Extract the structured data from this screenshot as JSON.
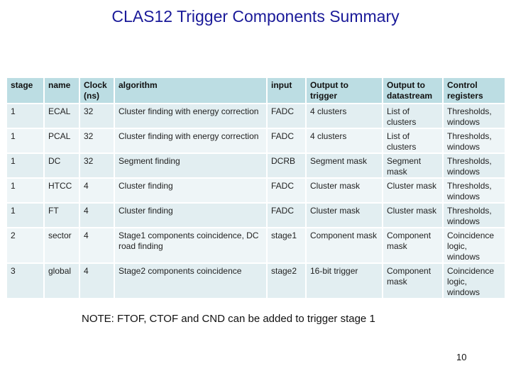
{
  "slide": {
    "title": "CLAS12 Trigger Components Summary",
    "note": "NOTE: FTOF, CTOF and CND can be added to trigger stage 1",
    "page_number": "10"
  },
  "table": {
    "headers": [
      "stage",
      "name",
      "Clock (ns)",
      "algorithm",
      "input",
      "Output to trigger",
      "Output to datastream",
      "Control registers"
    ],
    "rows": [
      [
        "1",
        "ECAL",
        "32",
        "Cluster finding with energy correction",
        "FADC",
        "4 clusters",
        "List of clusters",
        "Thresholds, windows"
      ],
      [
        "1",
        "PCAL",
        "32",
        "Cluster finding with energy correction",
        "FADC",
        "4 clusters",
        "List of clusters",
        "Thresholds, windows"
      ],
      [
        "1",
        "DC",
        "32",
        "Segment finding",
        "DCRB",
        "Segment mask",
        "Segment mask",
        "Thresholds, windows"
      ],
      [
        "1",
        "HTCC",
        "4",
        "Cluster finding",
        "FADC",
        "Cluster mask",
        "Cluster mask",
        "Thresholds, windows"
      ],
      [
        "1",
        "FT",
        "4",
        "Cluster finding",
        "FADC",
        "Cluster mask",
        "Cluster mask",
        "Thresholds, windows"
      ],
      [
        "2",
        "sector",
        "4",
        "Stage1 components coincidence, DC road finding",
        "stage1",
        "Component mask",
        "Component mask",
        "Coincidence logic, windows"
      ],
      [
        "3",
        "global",
        "4",
        "Stage2 components coincidence",
        "stage2",
        "16-bit trigger",
        "Component mask",
        "Coincidence logic, windows"
      ]
    ]
  }
}
